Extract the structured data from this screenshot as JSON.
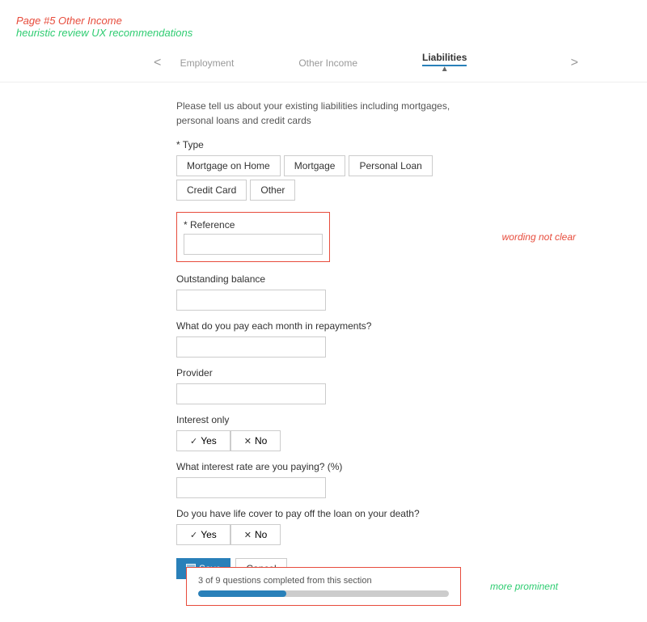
{
  "header": {
    "page_title": "Page #5  Other Income",
    "page_subtitle": "heuristic review UX recommendations"
  },
  "nav": {
    "left_arrow": "<",
    "right_arrow": ">",
    "steps": [
      {
        "id": "employment",
        "label": "Employment",
        "active": false
      },
      {
        "id": "other-income",
        "label": "Other Income",
        "active": false
      },
      {
        "id": "liabilities",
        "label": "Liabilities",
        "active": true
      }
    ],
    "up_arrow": "▲"
  },
  "form": {
    "description": "Please tell us about your existing liabilities including mortgages, personal loans and credit cards",
    "type_label": "* Type",
    "type_buttons": [
      "Mortgage on Home",
      "Mortgage",
      "Personal Loan",
      "Credit Card",
      "Other"
    ],
    "reference_label": "* Reference",
    "reference_annotation": "wording not clear",
    "reference_placeholder": "",
    "outstanding_balance_label": "Outstanding balance",
    "repayments_label": "What do you pay each month in repayments?",
    "provider_label": "Provider",
    "interest_only_label": "Interest only",
    "yes_label": "Yes",
    "no_label": "No",
    "interest_rate_label": "What interest rate are you paying? (%)",
    "life_cover_label": "Do you have life cover to pay off the loan on your death?",
    "save_label": "Save",
    "cancel_label": "Cancel"
  },
  "progress": {
    "text": "3 of 9 questions completed from this section",
    "fill_percent": 35,
    "annotation": "more prominent"
  }
}
